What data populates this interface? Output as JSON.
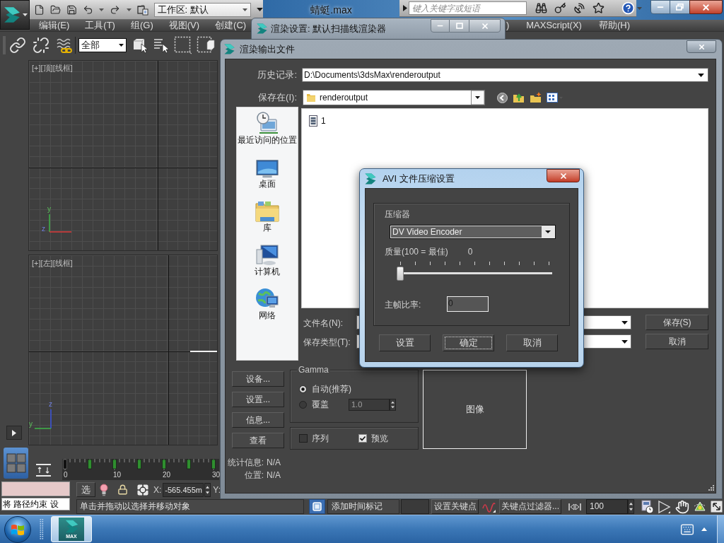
{
  "app": {
    "title": "蜻蜓.max",
    "workspace": "工作区: 默认",
    "search": {
      "placeholder": "键入关键字或短语"
    }
  },
  "menu": [
    "编辑(E)",
    "工具(T)",
    "组(G)",
    "视图(V)",
    "创建(C)"
  ],
  "menu_right": [
    ")",
    "MAXScript(X)",
    "帮助(H)"
  ],
  "toolbar": {
    "selection_filter": "全部"
  },
  "viewports": [
    {
      "label": "[+][顶][线框]",
      "axes": [
        "y",
        "z"
      ]
    },
    {
      "label": "[+][左][线框]",
      "axes": [
        "z",
        "y"
      ]
    }
  ],
  "timeline": {
    "labels": [
      "0",
      "10",
      "20",
      "30"
    ]
  },
  "status": {
    "listener_output": "将 路径约束 设",
    "select_button": "选",
    "x_label": "X:",
    "x_value": "-565.455m",
    "y_label": "Y:",
    "prompt": "单击并拖动以选择并移动对象",
    "time_tag": "添加时间标记",
    "set_key": "设置关键点",
    "key_filters": "关键点过滤器...",
    "frame": "100"
  },
  "render_setup": {
    "title": "渲染设置: 默认扫描线渲染器"
  },
  "output_dialog": {
    "title": "渲染输出文件",
    "history_label": "历史记录:",
    "history": "D:\\Documents\\3dsMax\\renderoutput",
    "save_in_label": "保存在(I):",
    "save_in": "renderoutput",
    "places": [
      {
        "kind": "recent",
        "label": "最近访问的位置"
      },
      {
        "kind": "desktop",
        "label": "桌面"
      },
      {
        "kind": "library",
        "label": "库"
      },
      {
        "kind": "computer",
        "label": "计算机"
      },
      {
        "kind": "network",
        "label": "网络"
      }
    ],
    "files": [
      "1"
    ],
    "filename_label": "文件名(N):",
    "filetype_label": "保存类型(T):",
    "save_button": "保存(S)",
    "cancel_button": "取消",
    "side_buttons": [
      "设备...",
      "设置...",
      "信息...",
      "查看"
    ],
    "gamma": {
      "title": "Gamma",
      "options": [
        {
          "label": "自动(推荐)",
          "selected": true
        },
        {
          "label": "覆盖",
          "selected": false,
          "value": "1.0",
          "disabled": true
        }
      ]
    },
    "render_options": [
      {
        "label": "序列",
        "checked": false
      },
      {
        "label": "预览",
        "checked": true
      }
    ],
    "image_label": "图像",
    "stats": [
      {
        "label": "统计信息:",
        "value": "N/A"
      },
      {
        "label": "位置:",
        "value": "N/A"
      }
    ]
  },
  "avi_dialog": {
    "title": "AVI 文件压缩设置",
    "compressor_label": "压缩器",
    "compressor": "DV Video Encoder",
    "quality_label": "质量(100 = 最佳)",
    "quality_value": "0",
    "quality": {
      "level": 0
    },
    "keyframe_label": "主帧比率:",
    "keyframe_value": "0",
    "buttons": [
      {
        "label": "设置",
        "focused": false
      },
      {
        "label": "确定",
        "focused": true
      },
      {
        "label": "取消",
        "focused": false
      }
    ]
  },
  "taskbar": {
    "app_label": "MAX"
  }
}
